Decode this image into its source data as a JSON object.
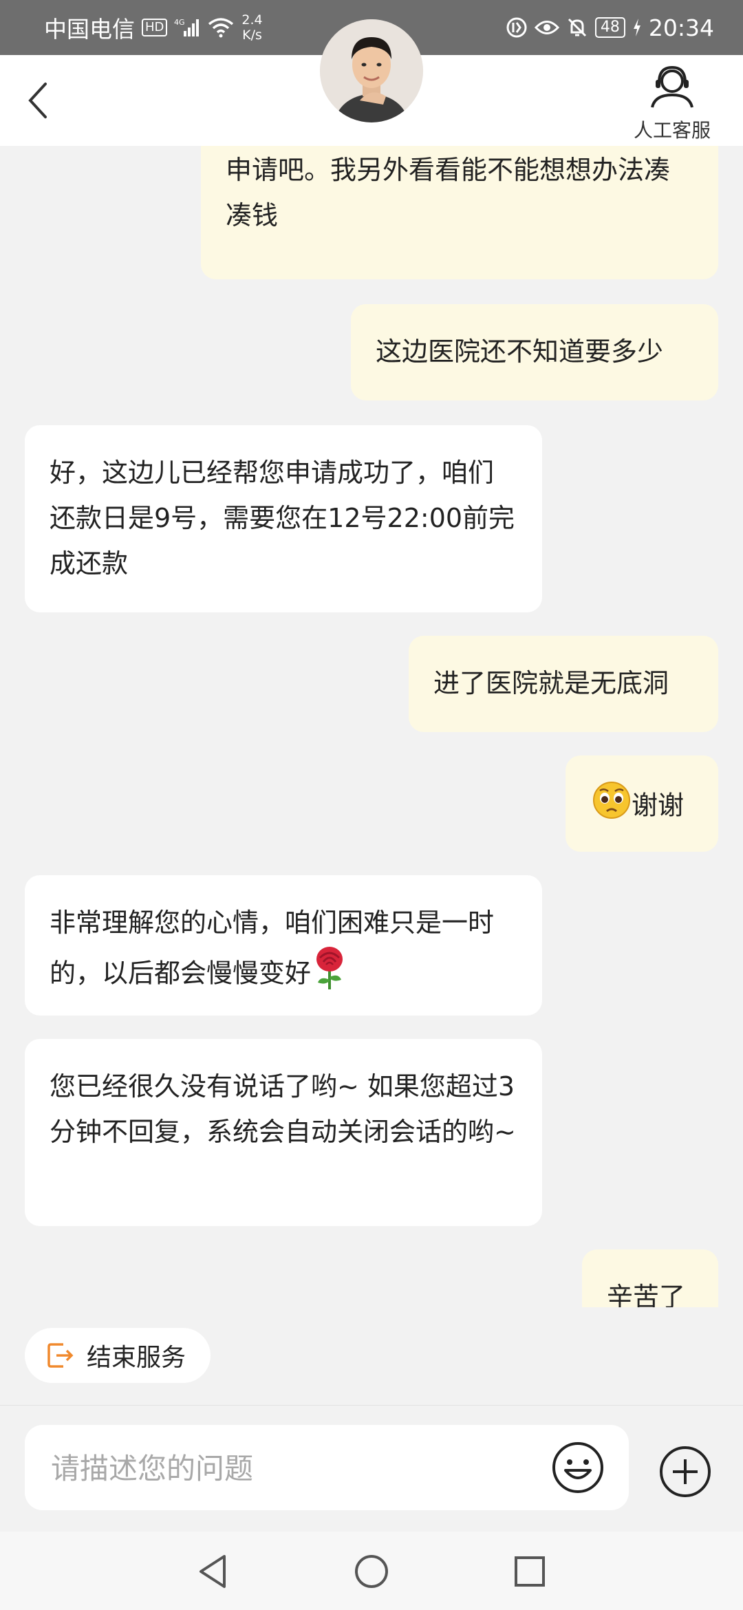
{
  "status_bar": {
    "carrier": "中国电信",
    "hd": "HD",
    "signal_type": "4G",
    "speed_value": "2.4",
    "speed_unit": "K/s",
    "battery": "48",
    "time": "20:34"
  },
  "header": {
    "customer_service_label": "人工客服"
  },
  "messages": [
    {
      "side": "right",
      "text": "申请吧。我另外看看能不能想想办法凑凑钱"
    },
    {
      "side": "right",
      "text": "这边医院还不知道要多少"
    },
    {
      "side": "left",
      "text": "好，这边儿已经帮您申请成功了，咱们还款日是9号，需要您在12号22:00前完成还款"
    },
    {
      "side": "right",
      "text": "进了医院就是无底洞"
    },
    {
      "side": "right",
      "text": "谢谢",
      "emoji": "pleading-face-emoji"
    },
    {
      "side": "left",
      "text": "非常理解您的心情，咱们困难只是一时的，以后都会慢慢变好",
      "emoji": "rose-emoji"
    },
    {
      "side": "left",
      "text": "您已经很久没有说话了哟~ 如果您超过3分钟不回复，系统会自动关闭会话的哟~"
    },
    {
      "side": "right",
      "text": "辛苦了"
    }
  ],
  "end_service": {
    "label": "结束服务",
    "icon": "exit-icon"
  },
  "input": {
    "placeholder": "请描述您的问题",
    "value": ""
  },
  "colors": {
    "status_bar": "#6e6e6e",
    "user_bubble": "#fdf9e3",
    "agent_bubble": "#ffffff",
    "accent_orange": "#f0892d",
    "background": "#f2f2f2"
  }
}
